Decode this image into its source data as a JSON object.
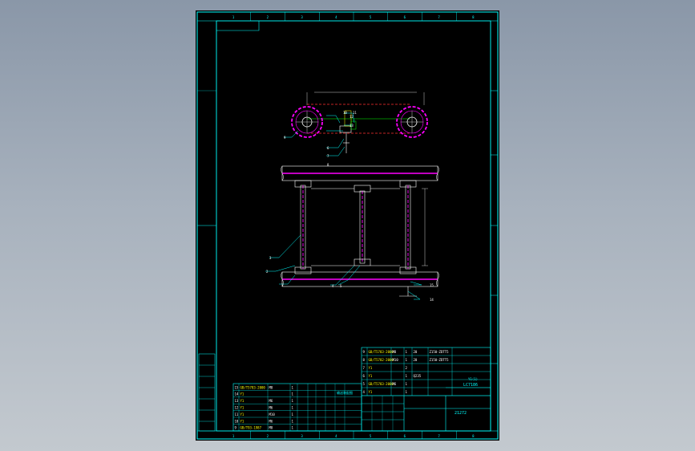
{
  "drawing": {
    "zone_numbers": [
      "1",
      "2",
      "3",
      "4",
      "5",
      "6",
      "7",
      "8"
    ],
    "callouts": [
      "1",
      "2",
      "3",
      "4",
      "5",
      "6",
      "7",
      "8",
      "9",
      "10",
      "11",
      "12",
      "13",
      "14",
      "15"
    ],
    "title_block": {
      "part_code": "LC7186",
      "drawing_no": "21272",
      "assembly_label": "输送装配图",
      "material": "Y1(1)"
    },
    "bom_right": [
      [
        "9",
        "GB/T5783-2000",
        "M8",
        "1",
        "20",
        "Z150-ZDTT5"
      ],
      [
        "8",
        "GB/T5782-2000",
        "M10",
        "1",
        "20",
        "Z150-ZDTT5"
      ],
      [
        "7",
        "Y1",
        "",
        "2",
        "",
        ""
      ],
      [
        "6",
        "Y1",
        "",
        "1",
        "Q235",
        ""
      ],
      [
        "5",
        "GB/T5783-2000",
        "M6",
        "1",
        "",
        ""
      ],
      [
        "4",
        "Y1",
        "",
        "1",
        "",
        ""
      ]
    ],
    "bom_left": [
      [
        "15",
        "GB/T5783-2000",
        "M8",
        "1",
        ""
      ],
      [
        "14",
        "Y1",
        "",
        "1",
        ""
      ],
      [
        "13",
        "Y1",
        "M6",
        "1",
        ""
      ],
      [
        "12",
        "Y1",
        "M6",
        "1",
        ""
      ],
      [
        "11",
        "Y1",
        "M10",
        "1",
        ""
      ],
      [
        "10",
        "Y1",
        "M6",
        "1",
        ""
      ],
      [
        "9",
        "GB/T93-1987",
        "M8",
        "1",
        ""
      ]
    ]
  }
}
